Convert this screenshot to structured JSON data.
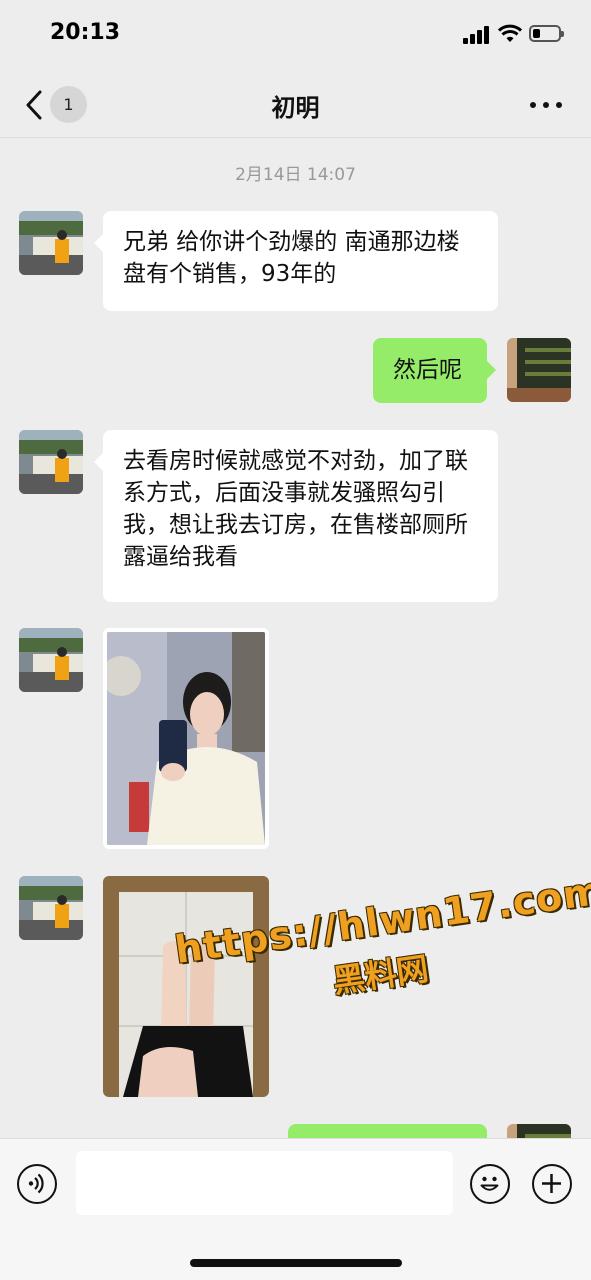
{
  "status_bar": {
    "time": "20:13",
    "battery_level": 0.3
  },
  "nav": {
    "back_badge": "1",
    "title": "初明",
    "more_icon": "more-dots-icon"
  },
  "timestamp": "2月14日 14:07",
  "messages": [
    {
      "from": "contact",
      "type": "text",
      "text": "兄弟 给你讲个劲爆的 南通那边楼盘有个销售，93年的"
    },
    {
      "from": "me",
      "type": "text",
      "text": "然后呢"
    },
    {
      "from": "contact",
      "type": "text",
      "text": "去看房时候就感觉不对劲，加了联系方式，后面没事就发骚照勾引我，想让我去订房，在售楼部厕所露逼给我看"
    },
    {
      "from": "contact",
      "type": "image"
    },
    {
      "from": "contact",
      "type": "image"
    },
    {
      "from": "me",
      "type": "text",
      "text": ""
    }
  ],
  "watermark": {
    "url": "https://hlwn17.com",
    "name": "黑料网"
  },
  "input_bar": {
    "placeholder": "",
    "icons": [
      "voice-icon",
      "emoji-icon",
      "plus-icon"
    ]
  },
  "colors": {
    "background": "#ededed",
    "bubble_out": "#95ec69",
    "bubble_in": "#ffffff",
    "watermark": "#f0a020"
  }
}
